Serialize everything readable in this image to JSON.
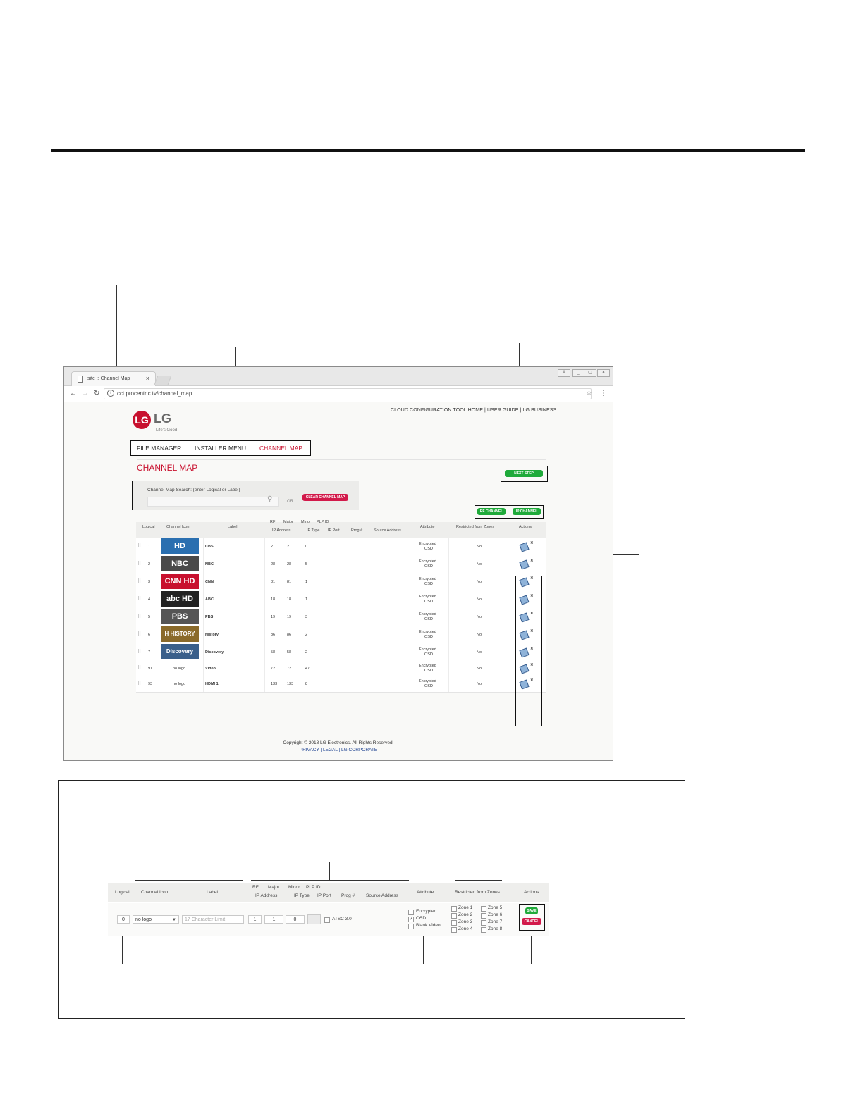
{
  "browser": {
    "tab_title": "site :: Channel Map",
    "tab_close": "×",
    "url": "cct.procentric.tv/channel_map",
    "win_buttons": [
      "A",
      "_",
      "▢",
      "✕"
    ]
  },
  "header": {
    "top_links": "CLOUD CONFIGURATION TOOL HOME  |  USER GUIDE  |  LG BUSINESS",
    "logo_mark": "LG",
    "logo_text": "LG",
    "logo_tagline": "Life's Good"
  },
  "nav": {
    "file_manager": "FILE MANAGER",
    "installer_menu": "INSTALLER MENU",
    "channel_map": "CHANNEL MAP"
  },
  "page_title": "CHANNEL MAP",
  "buttons": {
    "next_step": "NEXT STEP",
    "rf_channel": "RF CHANNEL",
    "ip_channel": "IP CHANNEL",
    "clear_channel_map": "CLEAR CHANNEL MAP"
  },
  "search": {
    "label": "Channel Map Search: (enter Logical or Label)",
    "or": "OR"
  },
  "table": {
    "headers": {
      "logical": "Logical",
      "channel_icon": "Channel Icon",
      "label": "Label",
      "rf": "RF",
      "major": "Major",
      "minor": "Minor",
      "plp_id": "PLP ID",
      "ip_address": "IP Address",
      "ip_type": "IP Type",
      "ip_port": "IP Port",
      "prog": "Prog #",
      "source_address": "Source Address",
      "attribute": "Attribute",
      "restricted": "Restricted from Zones",
      "actions": "Actions"
    },
    "rows": [
      {
        "logical": "1",
        "icon": "HD",
        "icon_color": "#2a6fb0",
        "label": "CBS",
        "rf": "2",
        "major": "2",
        "minor": "0",
        "attr1": "Encrypted",
        "attr2": "OSD",
        "restricted": "No"
      },
      {
        "logical": "2",
        "icon": "NBC",
        "icon_color": "#4a4a4a",
        "label": "NBC",
        "rf": "28",
        "major": "28",
        "minor": "5",
        "attr1": "Encrypted",
        "attr2": "OSD",
        "restricted": "No"
      },
      {
        "logical": "3",
        "icon": "CNN HD",
        "icon_color": "#c8102e",
        "label": "CNN",
        "rf": "81",
        "major": "81",
        "minor": "1",
        "attr1": "Encrypted",
        "attr2": "OSD",
        "restricted": "No"
      },
      {
        "logical": "4",
        "icon": "abc HD",
        "icon_color": "#222222",
        "label": "ABC",
        "rf": "18",
        "major": "18",
        "minor": "1",
        "attr1": "Encrypted",
        "attr2": "OSD",
        "restricted": "No"
      },
      {
        "logical": "5",
        "icon": "PBS",
        "icon_color": "#555555",
        "label": "PBS",
        "rf": "19",
        "major": "19",
        "minor": "3",
        "attr1": "Encrypted",
        "attr2": "OSD",
        "restricted": "No"
      },
      {
        "logical": "6",
        "icon": "H HISTORY",
        "icon_color": "#8a6a2a",
        "label": "History",
        "rf": "86",
        "major": "86",
        "minor": "2",
        "attr1": "Encrypted",
        "attr2": "OSD",
        "restricted": "No"
      },
      {
        "logical": "7",
        "icon": "Discovery",
        "icon_color": "#3a5f8a",
        "label": "Discovery",
        "rf": "58",
        "major": "58",
        "minor": "2",
        "attr1": "Encrypted",
        "attr2": "OSD",
        "restricted": "No"
      },
      {
        "logical": "91",
        "icon": "no logo",
        "icon_color": "",
        "label": "Video",
        "rf": "72",
        "major": "72",
        "minor": "47",
        "attr1": "Encrypted",
        "attr2": "OSD",
        "restricted": "No"
      },
      {
        "logical": "93",
        "icon": "no logo",
        "icon_color": "",
        "label": "HDMI 1",
        "rf": "133",
        "major": "133",
        "minor": "8",
        "attr1": "Encrypted",
        "attr2": "OSD",
        "restricted": "No"
      }
    ]
  },
  "footer": {
    "copyright": "Copyright © 2018 LG Electronics. All Rights Reserved.",
    "links": "PRIVACY | LEGAL | LG CORPORATE"
  },
  "edit_row": {
    "headers": {
      "logical": "Logical",
      "channel_icon": "Channel Icon",
      "label": "Label",
      "rf": "RF",
      "major": "Major",
      "minor": "Minor",
      "plp_id": "PLP ID",
      "ip_address": "IP Address",
      "ip_type": "IP Type",
      "ip_port": "IP Port",
      "prog": "Prog #",
      "source_address": "Source Address",
      "attribute": "Attribute",
      "restricted": "Restricted from Zones",
      "actions": "Actions"
    },
    "logical_value": "0",
    "icon_select": "no logo",
    "label_placeholder": "17 Character Limit",
    "rf_value": "1",
    "major_value": "1",
    "minor_value": "0",
    "atsc": "ATSC 3.0",
    "attributes": [
      {
        "label": "Encrypted",
        "checked": false
      },
      {
        "label": "OSD",
        "checked": true
      },
      {
        "label": "Blank Video",
        "checked": false
      }
    ],
    "zones": [
      "Zone 1",
      "Zone 2",
      "Zone 3",
      "Zone 4",
      "Zone 5",
      "Zone 6",
      "Zone 7",
      "Zone 8"
    ],
    "save": "SAVE",
    "cancel": "CANCEL"
  },
  "colors": {
    "lg_red": "#c8102e",
    "green": "#1faa3a",
    "pink": "#d2194a"
  }
}
